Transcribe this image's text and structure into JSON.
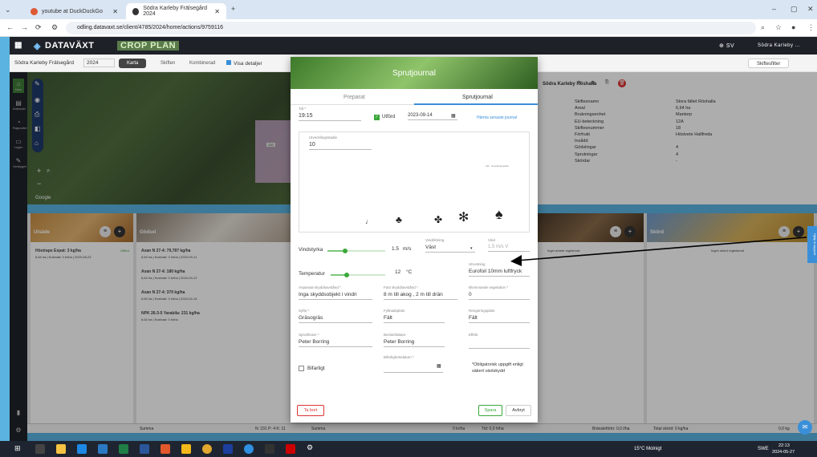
{
  "browser": {
    "tabs": [
      {
        "label": "youtube at DuckDuckGo"
      },
      {
        "label": "Södra Karleby Frälsegård 2024"
      }
    ],
    "url": "odling.datavaxt.se/client/4785/2024/home/actions/9759116"
  },
  "app": {
    "brand": "DATAVÄXT",
    "product": "CROP PLAN",
    "lang": "SV",
    "user": "Södra Karleby ..."
  },
  "subbar": {
    "farm": "Södra Karleby Frälsegård",
    "year": "2024",
    "modes": [
      "Karta",
      "Skiften",
      "Kombinerad"
    ],
    "details": "Visa detaljer",
    "filter": "Skiftesfilter"
  },
  "sidebar": {
    "items": [
      "Hem",
      "Kalender",
      "Rapporter",
      "Lager",
      "Verktyget"
    ]
  },
  "map": {
    "field_label": "120",
    "google": "Google"
  },
  "info": {
    "header": "Södra Karleby Röshalla",
    "rows": [
      {
        "k": "Skiftesnamn",
        "v": "Stora fältet Röshalla"
      },
      {
        "k": "Areal",
        "v": "6,64 ha"
      },
      {
        "k": "Brukningsenhet",
        "v": "Mantorp"
      },
      {
        "k": "EU-beteckning",
        "v": "12A"
      },
      {
        "k": "Skiftesnummer",
        "v": "18"
      },
      {
        "k": "Förfrukt",
        "v": "Höstvete Hallfreda"
      },
      {
        "k": "Insådd",
        "v": ""
      },
      {
        "k": "Gödslingar",
        "v": "4"
      },
      {
        "k": "Sprutningar",
        "v": "4"
      },
      {
        "k": "Skördar",
        "v": "-"
      }
    ]
  },
  "cards": {
    "utsade": {
      "label": "Utsäde",
      "lines": [
        "Höstraps Expat: 3 kg/ha",
        "6,64 ha | Kostnad: 0 kr/ha | 2023-08-23"
      ],
      "badge": "Utförd"
    },
    "godsel": {
      "label": "Gödsel",
      "lines": [
        "Axan N 27-4: 79,787 kg/ha",
        "6,64 ha | Kostnad: 0 kr/ha | 2023-09-11",
        "Axan N 27-4: 180 kg/ha",
        "6,64 ha | Kostnad: 0 kr/ha | 2024-03-12",
        "Axan N 27-4: 370 kg/ha",
        "6,64 ha | Kostnad: 0 kr/ha | 2024-04-15",
        "NPK 26-3-5 Yarabila: 231 kg/ha",
        "6,64 ha | Kostnad: 0 kr/ha"
      ]
    },
    "arbete": {
      "lines": [
        "Inget arbete registrerat"
      ]
    },
    "skord": {
      "label": "Skörd",
      "lines": [
        "Ingen skörd registrerad"
      ]
    }
  },
  "bottom": {
    "summa1": "Summa",
    "n": "N: 231  P: 4  K: 11",
    "summa2": "Summa",
    "kr": "0 kr/ha",
    "tid": "Tid: 0,0 h/ha",
    "bransle": "Bränsleförbr: 0,0 l/ha",
    "total": "Total skörd: 0 kg/ha",
    "kg": "0,0 kg"
  },
  "modal": {
    "title": "Sprutjournal",
    "tabs": [
      "Preparat",
      "Sprutjournal"
    ],
    "tid_label": "Tid *",
    "tid": "19:15",
    "utford": "Utförd",
    "date": "2023-09-14",
    "fetch": "Hämta senaste journal",
    "utvecklingsstadie_label": "Utvecklingsstadie",
    "utvecklingsstadie": "10",
    "vindstyrka_label": "Vindstyrka",
    "vindstyrka": "1.5",
    "vind_unit": "m/s",
    "vindriktning_label": "Vindriktning",
    "vindriktning": "Väst",
    "vind_label": "Vind",
    "vind": "1.5 m/s V",
    "temp_label": "Temperatur",
    "temp": "12",
    "temp_unit": "°C",
    "utrustning_label": "Utrustning",
    "utrustning": "Eurofoil 10mm luftfryck",
    "skydd1_label": "Anpassat skyddsavstånd *",
    "skydd1": "Inga skyddsobjekt i vindri",
    "skydd2_label": "Fast skyddsavstånd *",
    "skydd2": "8 m till akog , 2 m till drän",
    "blommande_label": "Blommande vegetation *",
    "blommande": "0",
    "syfte_label": "Syfte *",
    "syfte": "Gräsogräs",
    "fyllnad_label": "Fyllnadsplats",
    "fyllnad": "Fält",
    "rengoring_label": "Rengöringsplats",
    "rengoring": "Fält",
    "sprutforare_label": "Sprutförare *",
    "sprutforare": "Peter Borring",
    "beslut_label": "Beslutsfattare",
    "beslut": "Peter Borring",
    "effekt_label": "Effekt",
    "effekt": "",
    "bifarligt": "Bifarligt",
    "bifdatum_label": "Bifarlighetsdatum *",
    "note": "*Obligatorisk uppgift enligt säkert växtskydd",
    "delete": "Ta bort",
    "save": "Spara",
    "cancel": "Avbryt",
    "scale_text": "Alm. utvecklingsskala"
  },
  "sidetab": "Hjälp & support",
  "taskbar": {
    "weather": "15°C Molnigt",
    "lang": "SWE",
    "time": "22:13",
    "date": "2024-05-27"
  }
}
